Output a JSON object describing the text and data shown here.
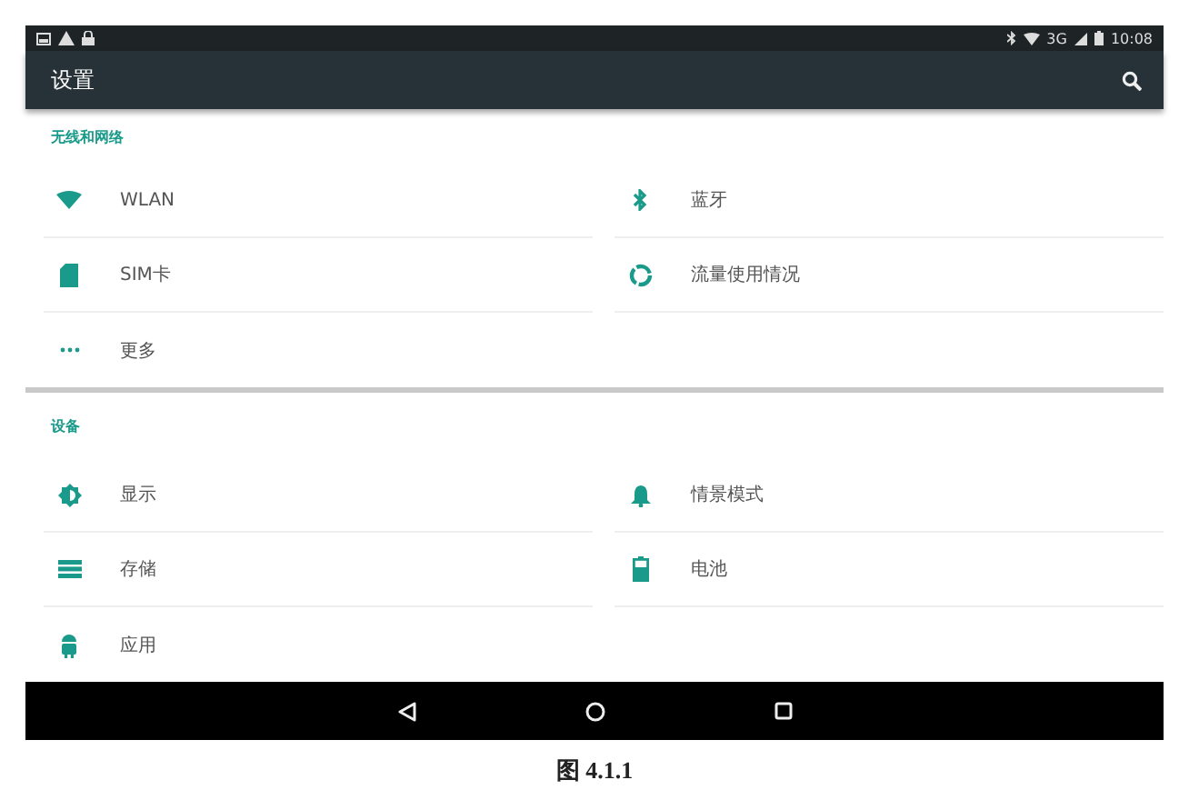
{
  "status_bar": {
    "network": "3G",
    "time": "10:08"
  },
  "app_bar": {
    "title": "设置"
  },
  "sections": [
    {
      "title": "无线和网络",
      "items": [
        {
          "label": "WLAN"
        },
        {
          "label": "蓝牙"
        },
        {
          "label": "SIM卡"
        },
        {
          "label": "流量使用情况"
        },
        {
          "label": "更多"
        }
      ]
    },
    {
      "title": "设备",
      "items": [
        {
          "label": "显示"
        },
        {
          "label": "情景模式"
        },
        {
          "label": "存储"
        },
        {
          "label": "电池"
        },
        {
          "label": "应用"
        }
      ]
    }
  ],
  "caption": "图 4.1.1"
}
